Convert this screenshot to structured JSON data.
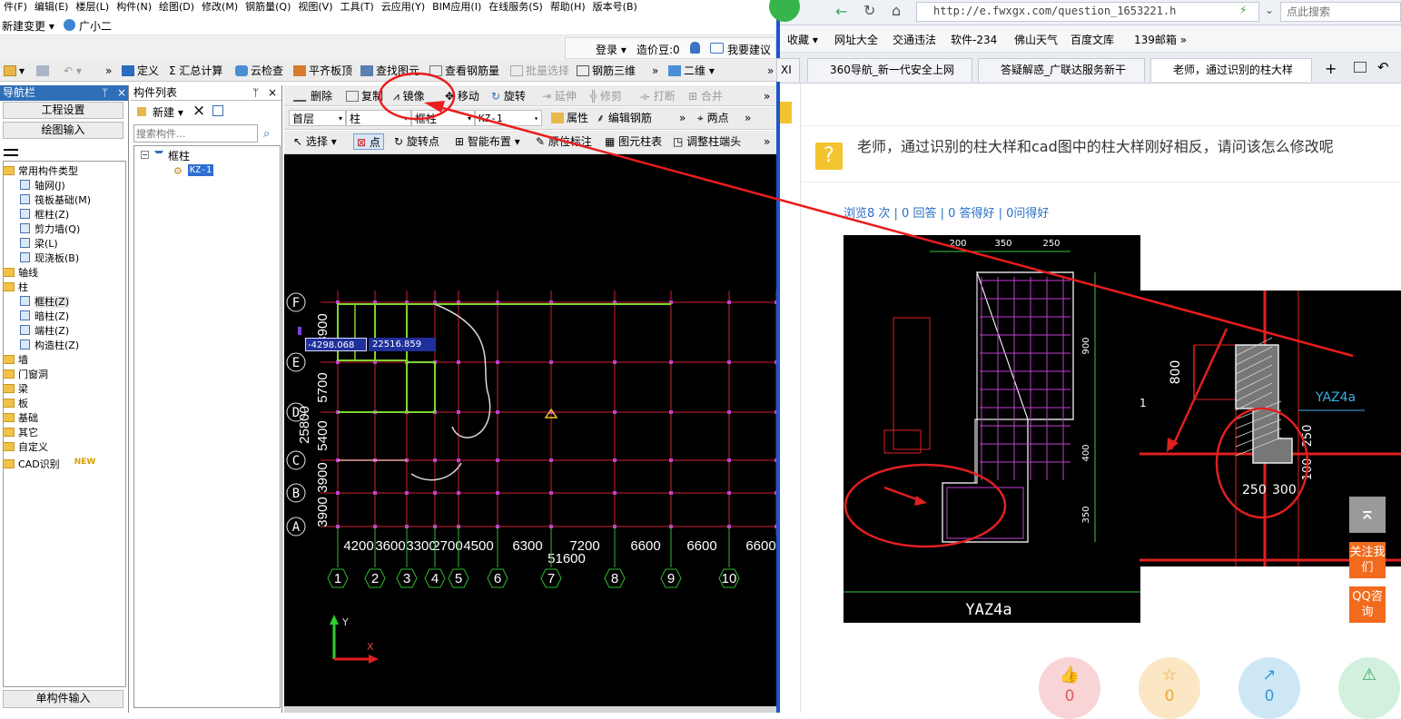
{
  "menubar": [
    "件(F)",
    "编辑(E)",
    "楼层(L)",
    "构件(N)",
    "绘图(D)",
    "修改(M)",
    "钢筋量(Q)",
    "视图(V)",
    "工具(T)",
    "云应用(Y)",
    "BIM应用(I)",
    "在线服务(S)",
    "帮助(H)",
    "版本号(B)"
  ],
  "subbar": {
    "change": "新建变更 ▾",
    "assistant": "广小二"
  },
  "account": {
    "login": "登录 ▾",
    "cost": "造价豆:0",
    "suggest": "我要建议"
  },
  "toolbar1": {
    "define": "定义",
    "sum": "汇总计算",
    "cloud_check": "云检查",
    "flat_top": "平齐板顶",
    "find": "查找图元",
    "view_rebar": "查看钢筋量",
    "batch_select": "批量选择",
    "rebar_3d": "钢筋三维",
    "view_mode": "二维 ▾"
  },
  "nav": {
    "title": "导航栏",
    "project_settings": "工程设置",
    "draw_input": "绘图输入",
    "single_input": "单构件输入",
    "tree": [
      {
        "label": "常用构件类型",
        "level": 0
      },
      {
        "label": "轴网(J)",
        "level": 1
      },
      {
        "label": "筏板基础(M)",
        "level": 1
      },
      {
        "label": "框柱(Z)",
        "level": 1
      },
      {
        "label": "剪力墙(Q)",
        "level": 1
      },
      {
        "label": "梁(L)",
        "level": 1
      },
      {
        "label": "现浇板(B)",
        "level": 1
      },
      {
        "label": "轴线",
        "level": 0
      },
      {
        "label": "柱",
        "level": 0
      },
      {
        "label": "框柱(Z)",
        "level": 1
      },
      {
        "label": "暗柱(Z)",
        "level": 1
      },
      {
        "label": "端柱(Z)",
        "level": 1
      },
      {
        "label": "构造柱(Z)",
        "level": 1
      },
      {
        "label": "墙",
        "level": 0
      },
      {
        "label": "门窗洞",
        "level": 0
      },
      {
        "label": "梁",
        "level": 0
      },
      {
        "label": "板",
        "level": 0
      },
      {
        "label": "基础",
        "level": 0
      },
      {
        "label": "其它",
        "level": 0
      },
      {
        "label": "自定义",
        "level": 0
      },
      {
        "label": "CAD识别",
        "level": 0
      }
    ],
    "new_badge": "NEW"
  },
  "components": {
    "title": "构件列表",
    "new_btn": "新建 ▾",
    "search_placeholder": "搜索构件...",
    "root": "框柱",
    "item": "KZ-1"
  },
  "toolbar2": {
    "delete": "删除",
    "copy": "复制",
    "mirror": "镜像",
    "move": "移动",
    "rotate": "旋转",
    "extend": "延伸",
    "trim": "修剪",
    "break": "打断",
    "merge": "合并"
  },
  "toolbar3": {
    "floor": "首层",
    "category": "柱",
    "type": "框柱",
    "name": "KZ-1",
    "props": "属性",
    "edit_rebar": "编辑钢筋",
    "two_points": "两点"
  },
  "toolbar4": {
    "select": "选择 ▾",
    "point": "点",
    "rotate_point": "旋转点",
    "smart_layout": "智能布置 ▾",
    "in_place": "原位标注",
    "col_table": "图元柱表",
    "adjust_head": "调整柱端头"
  },
  "cad": {
    "coord_x": "-4298.068",
    "coord_y": "22516.859",
    "row_axes": [
      "F",
      "E",
      "D",
      "C",
      "B",
      "A"
    ],
    "row_dims": [
      "3900",
      "5700",
      "25800",
      "5400",
      "3900",
      "3900"
    ],
    "col_axes": [
      "1",
      "2",
      "3",
      "4",
      "5",
      "6",
      "7",
      "8",
      "9",
      "10"
    ],
    "col_dims": [
      "4200",
      "3600",
      "3300",
      "2700",
      "4500",
      "6300",
      "7200",
      "6600",
      "6600",
      "6600"
    ],
    "total_dim": "51600",
    "axis_y": "Y",
    "axis_x": "X"
  },
  "browser": {
    "url": "http://e.fwxgx.com/question_1653221.h",
    "search": "点此搜索",
    "favorites": [
      "收藏 ▾",
      "网址大全",
      "交通违法",
      "软件-234",
      "佛山天气",
      "百度文库",
      "139邮箱 »"
    ],
    "tabs": [
      "XI",
      "360导航_新一代安全上网",
      "答疑解惑_广联达服务新干",
      "老师，通过识别的柱大样"
    ]
  },
  "question": {
    "title": "老师，通过识别的柱大样和cad图中的柱大样刚好相反，请问该怎么修改呢",
    "stats": "浏览8 次 | 0 回答 | 0 答得好 | 0问得好"
  },
  "img_left": {
    "dims_top": [
      "200",
      "350",
      "250"
    ],
    "dims_right": [
      "900",
      "400",
      "350"
    ],
    "label": "YAZ4a"
  },
  "img_right": {
    "label": "YAZ4a",
    "dim_800": "800",
    "dim_250": "250",
    "dim_300": "300",
    "dim_v250": "250",
    "dim_v100": "100",
    "corner": "1"
  },
  "side": {
    "follow": "关注我们",
    "qq": "QQ咨询"
  },
  "actions": [
    {
      "name": "like",
      "count": "0",
      "color": "#f9d4d6",
      "fg": "#e05a63"
    },
    {
      "name": "fav",
      "count": "0",
      "color": "#fbe7c4",
      "fg": "#e6a936"
    },
    {
      "name": "share",
      "count": "0",
      "color": "#cde7f5",
      "fg": "#3a9ad5"
    },
    {
      "name": "report",
      "count": "",
      "color": "#d2f0dd",
      "fg": "#3aa860"
    }
  ]
}
